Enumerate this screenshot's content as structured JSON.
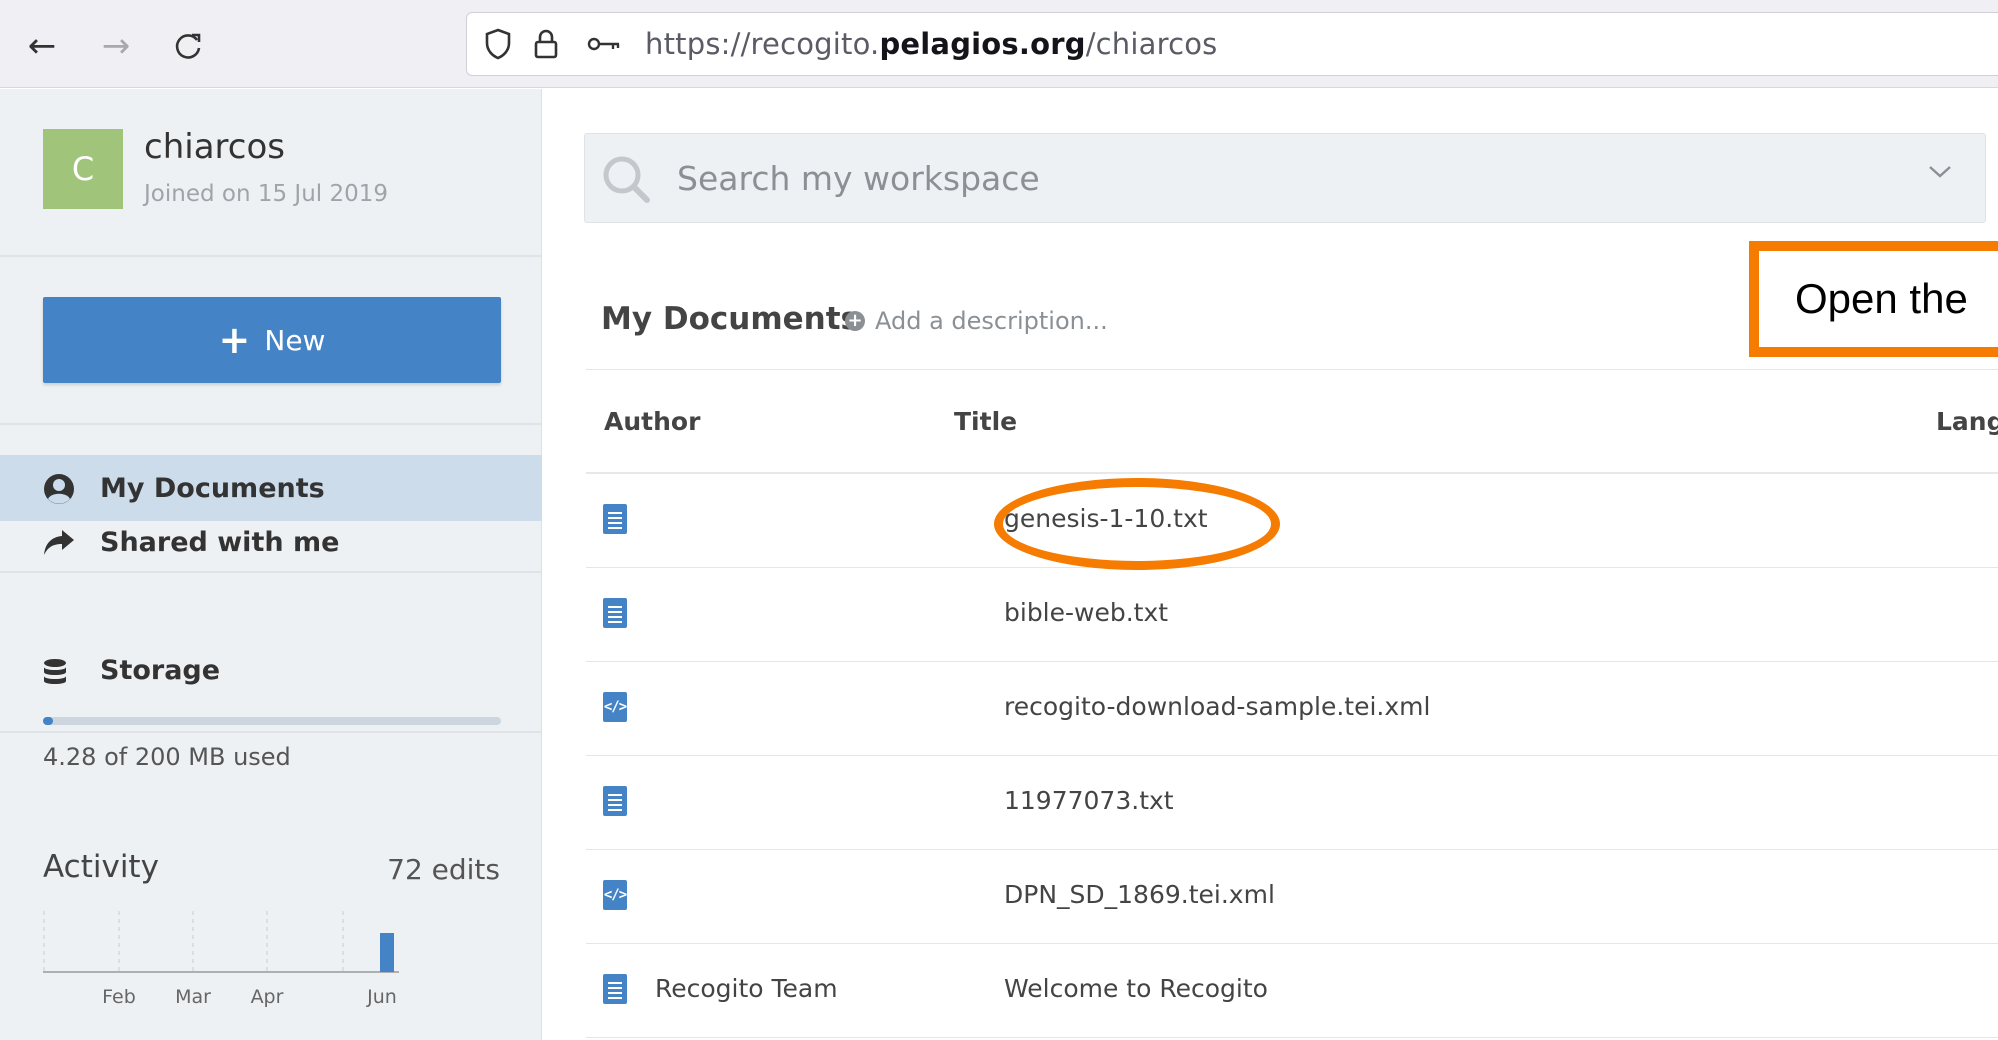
{
  "browser": {
    "url_prefix": "https://recogito.",
    "url_domain": "pelagios.org",
    "url_path": "/chiarcos"
  },
  "profile": {
    "avatar_letter": "C",
    "username": "chiarcos",
    "joined": "Joined on 15 Jul 2019"
  },
  "sidebar": {
    "new_label": "New",
    "items": [
      {
        "label": "My Documents",
        "icon": "user-circle-icon",
        "active": true
      },
      {
        "label": "Shared with me",
        "icon": "share-arrow-icon",
        "active": false
      }
    ],
    "storage_label": "Storage",
    "storage_used_fraction": 0.0214,
    "storage_text": "4.28 of 200 MB used",
    "activity_title": "Activity",
    "activity_count": "72 edits",
    "activity_months": [
      "Feb",
      "Mar",
      "Apr",
      "Jun"
    ]
  },
  "search": {
    "placeholder": "Search my workspace"
  },
  "documents": {
    "heading": "My Documents",
    "add_description": "Add a description...",
    "columns": [
      "Author",
      "Title",
      "Lang"
    ],
    "rows": [
      {
        "icon": "text-file-icon",
        "author": "",
        "title": "genesis-1-10.txt"
      },
      {
        "icon": "text-file-icon",
        "author": "",
        "title": "bible-web.txt"
      },
      {
        "icon": "xml-file-icon",
        "author": "",
        "title": "recogito-download-sample.tei.xml"
      },
      {
        "icon": "text-file-icon",
        "author": "",
        "title": "11977073.txt"
      },
      {
        "icon": "xml-file-icon",
        "author": "",
        "title": "DPN_SD_1869.tei.xml"
      },
      {
        "icon": "text-file-icon",
        "author": "Recogito Team",
        "title": "Welcome to Recogito"
      }
    ]
  },
  "callout": {
    "text": "Open the",
    "color": "#f57c00"
  },
  "colors": {
    "accent": "#4483c5",
    "avatar": "#9fc47a",
    "highlight": "#f57c00"
  }
}
